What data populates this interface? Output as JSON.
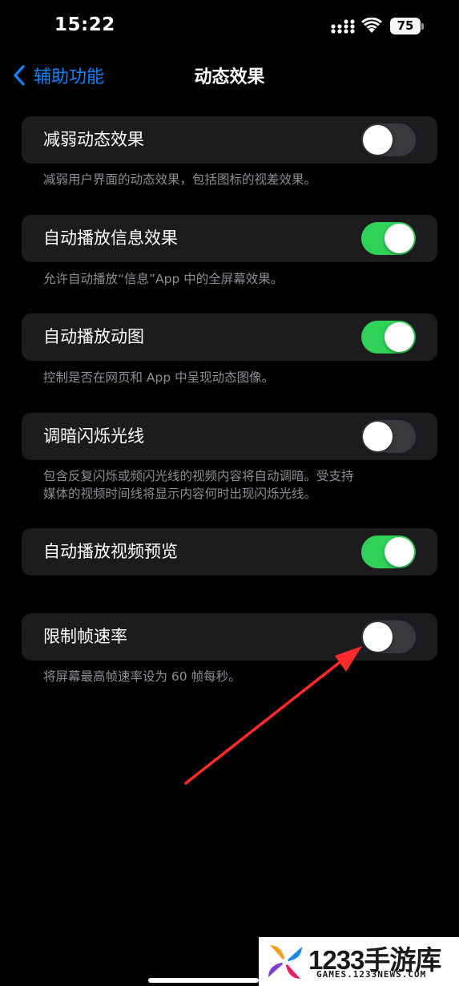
{
  "status_bar": {
    "time": "15:22",
    "battery_level": "75"
  },
  "nav": {
    "back_label": "辅助功能",
    "title": "动态效果"
  },
  "settings": [
    {
      "label": "减弱动态效果",
      "toggle_on": false,
      "footer": "减弱用户界面的动态效果，包括图标的视差效果。"
    },
    {
      "label": "自动播放信息效果",
      "toggle_on": true,
      "footer": "允许自动播放“信息”App 中的全屏幕效果。"
    },
    {
      "label": "自动播放动图",
      "toggle_on": true,
      "footer": "控制是否在网页和 App 中呈现动态图像。"
    },
    {
      "label": "调暗闪烁光线",
      "toggle_on": false,
      "footer_lines": [
        "包含反复闪烁或频闪光线的视频内容将自动调暗。受支持",
        "媒体的视频时间线将显示内容何时出现闪烁光线。"
      ]
    },
    {
      "label": "自动播放视频预览",
      "toggle_on": true
    },
    {
      "label": "限制帧速率",
      "toggle_on": false,
      "footer": "将屏幕最高帧速率设为 60 帧每秒。"
    }
  ],
  "watermark": {
    "brand": "1233手游库",
    "sub": "GAMES.1233NEWS.COM"
  },
  "colors": {
    "accent": "#0a84ff",
    "toggle_on": "#30d158",
    "toggle_off": "#39393d",
    "cell_bg": "#1c1c1e",
    "annotation_arrow": "#ff2a2a"
  }
}
